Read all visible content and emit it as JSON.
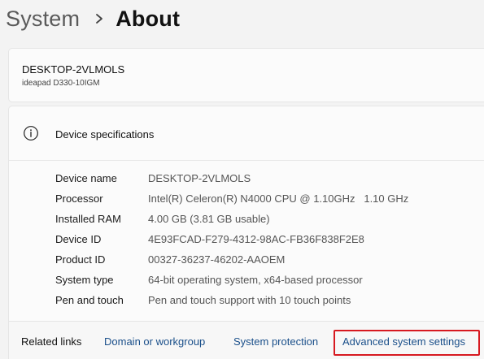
{
  "breadcrumb": {
    "parent": "System",
    "current": "About"
  },
  "device": {
    "name": "DESKTOP-2VLMOLS",
    "model": "ideapad D330-10IGM"
  },
  "specs": {
    "title": "Device specifications",
    "rows": [
      {
        "label": "Device name",
        "value": "DESKTOP-2VLMOLS"
      },
      {
        "label": "Processor",
        "value": "Intel(R) Celeron(R) N4000 CPU @ 1.10GHz   1.10 GHz"
      },
      {
        "label": "Installed RAM",
        "value": "4.00 GB (3.81 GB usable)"
      },
      {
        "label": "Device ID",
        "value": "4E93FCAD-F279-4312-98AC-FB36F838F2E8"
      },
      {
        "label": "Product ID",
        "value": "00327-36237-46202-AAOEM"
      },
      {
        "label": "System type",
        "value": "64-bit operating system, x64-based processor"
      },
      {
        "label": "Pen and touch",
        "value": "Pen and touch support with 10 touch points"
      }
    ]
  },
  "related": {
    "label": "Related links",
    "links": [
      {
        "label": "Domain or workgroup"
      },
      {
        "label": "System protection"
      },
      {
        "label": "Advanced system settings"
      }
    ]
  },
  "colors": {
    "link": "#1a4f8a",
    "highlight": "#d71920"
  },
  "icons": {
    "breadcrumb_separator": "chevron-right-icon",
    "specs": "info-icon"
  }
}
